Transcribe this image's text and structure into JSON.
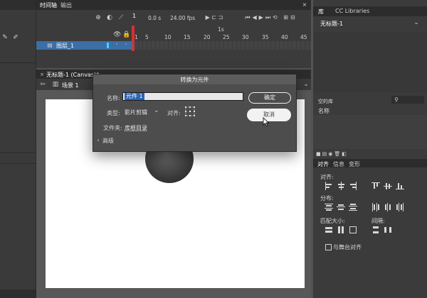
{
  "left_toolbar": {
    "tool_icons": [
      "pencil-icon",
      "brush-icon"
    ]
  },
  "timeline": {
    "tabs": [
      "时间轴",
      "输出"
    ],
    "fps_label": "24.00 fps",
    "frame_value": "1",
    "speed": "0.0 s",
    "ruler_second_label": "1s",
    "ruler_ticks": [
      "1",
      "5",
      "10",
      "15",
      "20",
      "25",
      "30",
      "35",
      "40",
      "45"
    ],
    "layer_name": "图层_1"
  },
  "document": {
    "tab_label": "无标题-1 (Canvas)*",
    "scene_label": "场景 1"
  },
  "library": {
    "tabs": [
      "库",
      "CC Libraries"
    ],
    "doc_select": "无标题-1",
    "item_count": "空的库",
    "name_column": "名称"
  },
  "align_panel": {
    "tabs": [
      "对齐",
      "信息",
      "变形"
    ],
    "align_label": "对齐:",
    "distribute_label": "分布:",
    "match_size_label": "匹配大小:",
    "spacing_label": "间隔:",
    "stage_checkbox_label": "与舞台对齐"
  },
  "dialog": {
    "title": "转换为元件",
    "name_label": "名称:",
    "name_value": "元件 1",
    "type_label": "类型:",
    "type_value": "影片剪辑",
    "align_label": "对齐:",
    "folder_label": "文件夹:",
    "folder_value": "库根目录",
    "advanced_label": "高级",
    "ok_label": "确定",
    "cancel_label": "取消"
  },
  "colors": {
    "app_bg": "#535353",
    "panel_bg": "#3e3e3e",
    "selected_layer": "#3d6ea5",
    "playhead": "#d83030",
    "dialog_bg": "#4d4d4d",
    "input_selection": "#2a64b4"
  }
}
